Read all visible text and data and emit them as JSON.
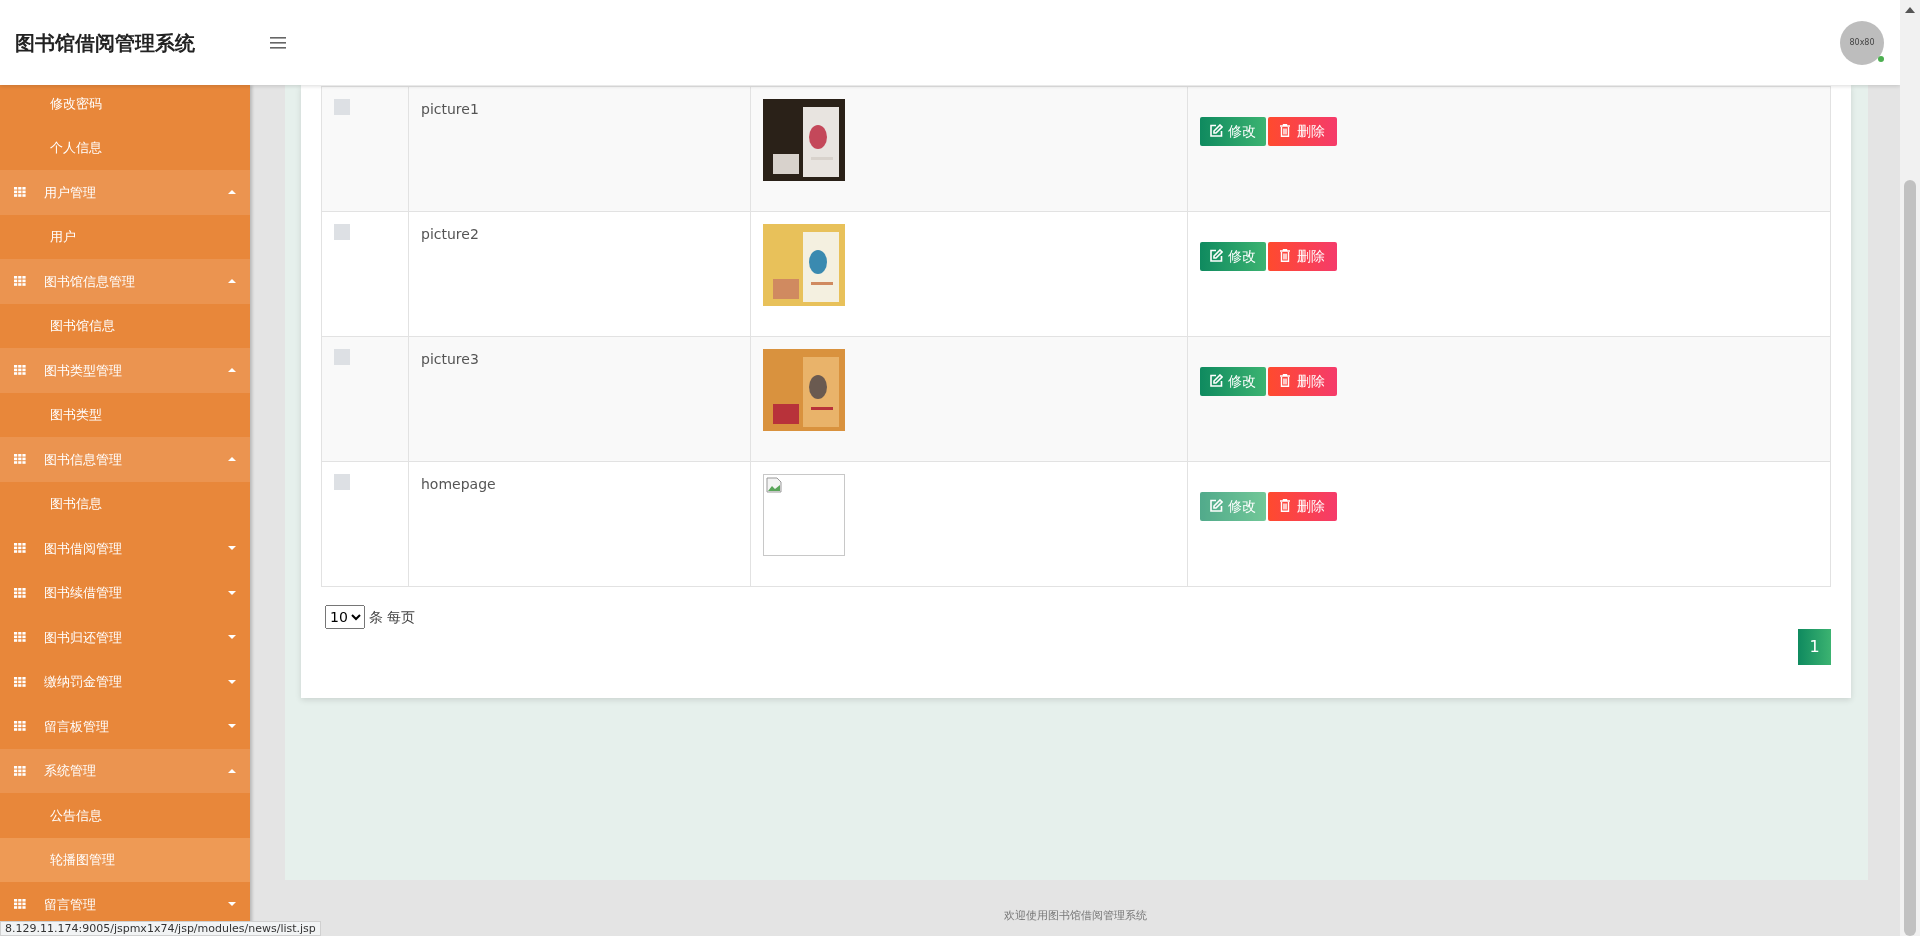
{
  "header": {
    "title": "图书馆借阅管理系统",
    "avatar_text": "80x80"
  },
  "sidebar": [
    {
      "kind": "item",
      "label": "修改密码",
      "selected": false
    },
    {
      "kind": "item",
      "label": "个人信息",
      "selected": false
    },
    {
      "kind": "group",
      "label": "用户管理",
      "expanded": true,
      "children": [
        {
          "kind": "item",
          "label": "用户",
          "selected": false
        }
      ]
    },
    {
      "kind": "group",
      "label": "图书馆信息管理",
      "expanded": true,
      "children": [
        {
          "kind": "item",
          "label": "图书馆信息",
          "selected": false
        }
      ]
    },
    {
      "kind": "group",
      "label": "图书类型管理",
      "expanded": true,
      "children": [
        {
          "kind": "item",
          "label": "图书类型",
          "selected": false
        }
      ]
    },
    {
      "kind": "group",
      "label": "图书信息管理",
      "expanded": true,
      "children": [
        {
          "kind": "item",
          "label": "图书信息",
          "selected": false
        }
      ]
    },
    {
      "kind": "group",
      "label": "图书借阅管理",
      "expanded": false
    },
    {
      "kind": "group",
      "label": "图书续借管理",
      "expanded": false
    },
    {
      "kind": "group",
      "label": "图书归还管理",
      "expanded": false
    },
    {
      "kind": "group",
      "label": "缴纳罚金管理",
      "expanded": false
    },
    {
      "kind": "group",
      "label": "留言板管理",
      "expanded": false
    },
    {
      "kind": "group",
      "label": "系统管理",
      "expanded": true,
      "children": [
        {
          "kind": "item",
          "label": "公告信息",
          "selected": false
        },
        {
          "kind": "item",
          "label": "轮播图管理",
          "selected": true
        }
      ]
    },
    {
      "kind": "group",
      "label": "留言管理",
      "expanded": false
    }
  ],
  "table": {
    "rows": [
      {
        "checked": false,
        "name": "picture1",
        "kind": "picture",
        "edit_label": "修改",
        "delete_label": "删除",
        "hovered": false
      },
      {
        "checked": false,
        "name": "picture2",
        "kind": "picture",
        "edit_label": "修改",
        "delete_label": "删除",
        "hovered": false
      },
      {
        "checked": false,
        "name": "picture3",
        "kind": "picture",
        "edit_label": "修改",
        "delete_label": "删除",
        "hovered": false
      },
      {
        "checked": false,
        "name": "homepage",
        "kind": "broken",
        "edit_label": "修改",
        "delete_label": "删除",
        "hovered": true
      }
    ]
  },
  "pager": {
    "page_size": "10",
    "page_size_label": "条 每页",
    "pages": [
      {
        "label": "1",
        "selected": true
      }
    ]
  },
  "footer": "欢迎使用图书馆借阅管理系统",
  "status_url": "8.129.11.174:9005/jspmx1x74/jsp/modules/news/list.jsp"
}
